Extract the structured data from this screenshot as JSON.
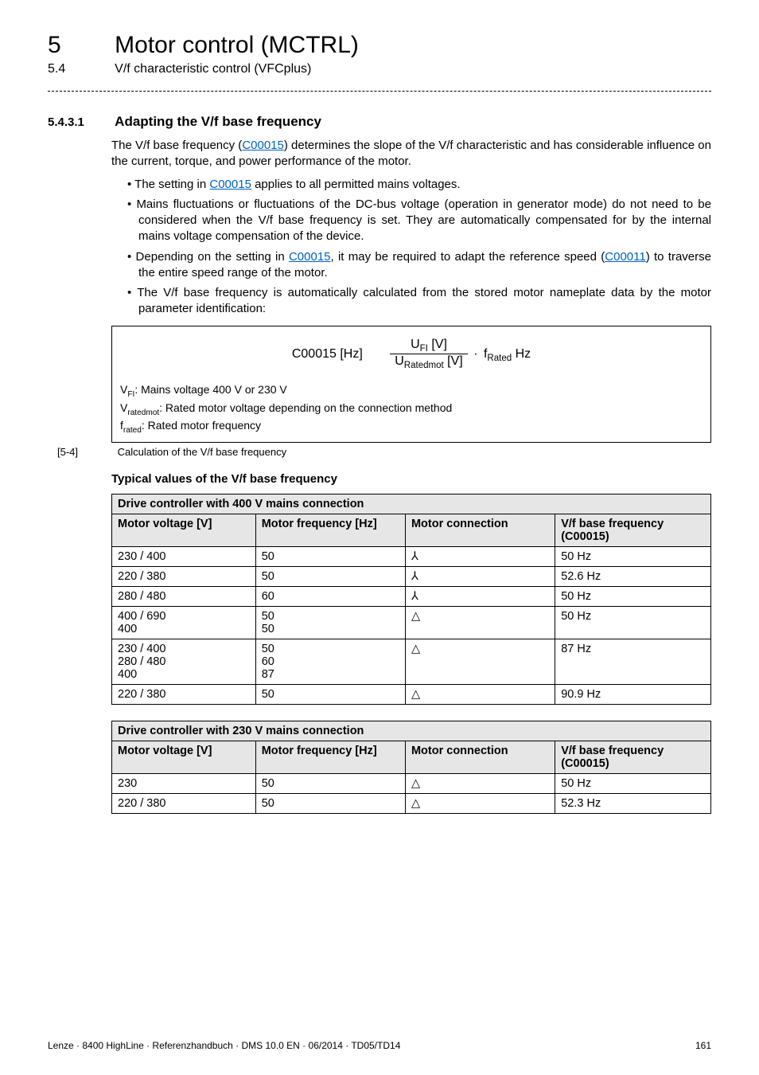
{
  "chapter": {
    "num": "5",
    "title": "Motor control (MCTRL)"
  },
  "subhead": {
    "num": "5.4",
    "title": "V/f characteristic control (VFCplus)"
  },
  "section": {
    "num": "5.4.3.1",
    "title": "Adapting the V/f base frequency"
  },
  "para1_parts": {
    "a": "The V/f base frequency (",
    "link": "C00015",
    "b": ") determines the slope of the V/f characteristic and has considerable influence on the current, torque, and power performance of the motor."
  },
  "bullets": {
    "b1": {
      "a": "The setting in ",
      "link": "C00015",
      "b": " applies to all permitted mains voltages."
    },
    "b2": "Mains fluctuations or fluctuations of the DC-bus voltage (operation in generator mode) do not need to be considered when the V/f base frequency is set. They are automatically compensated for by the internal mains voltage compensation of the device.",
    "b3": {
      "a": "Depending on the setting in ",
      "link1": "C00015",
      "b": ", it may be required to adapt the reference speed (",
      "link2": "C00011",
      "c": ") to traverse the entire speed range of the motor."
    },
    "b4": "The V/f base frequency is automatically calculated from the stored motor nameplate data by the motor parameter identification:"
  },
  "formula": {
    "lhs": "C00015 [Hz]",
    "num": "U<span class=\"sub\">FI</span> [V]",
    "den": "U<span class=\"sub\">Ratedmot</span> [V]",
    "trail": "<span class=\"dot\">·</span> f<span class=\"sub\">Rated</span> Hz",
    "legend": [
      "V<span class=\"sub\">FI</span>: Mains voltage 400 V or 230 V",
      "V<span class=\"sub\">ratedmot</span>: Rated motor voltage depending on the connection method",
      "f<span class=\"sub\">rated</span>: Rated motor frequency"
    ]
  },
  "caption": {
    "lbl": "[5-4]",
    "text": "Calculation of the V/f base frequency"
  },
  "typical_heading": "Typical values of the V/f base frequency",
  "table_header": {
    "c1": "Motor voltage [V]",
    "c2": "Motor frequency [Hz]",
    "c3": "Motor connection",
    "c4_a": "V/f base frequency",
    "c4_b": "(C00015)"
  },
  "table400": {
    "title": "Drive controller with 400 V mains connection",
    "rows": [
      {
        "v": "230 / 400",
        "f": "50",
        "conn": "⅄",
        "base": "50 Hz"
      },
      {
        "v": "220 / 380",
        "f": "50",
        "conn": "⅄",
        "base": "52.6 Hz"
      },
      {
        "v": "280 / 480",
        "f": "60",
        "conn": "⅄",
        "base": "50 Hz"
      },
      {
        "v": "400 / 690<br>400",
        "f": "50<br>50",
        "conn": "△",
        "base": "50 Hz"
      },
      {
        "v": "230 / 400<br>280 / 480<br>400",
        "f": "50<br>60<br>87",
        "conn": "△",
        "base": "87 Hz"
      },
      {
        "v": "220 / 380",
        "f": "50",
        "conn": "△",
        "base": "90.9 Hz"
      }
    ]
  },
  "table230": {
    "title": "Drive controller with 230 V mains connection",
    "rows": [
      {
        "v": "230",
        "f": "50",
        "conn": "△",
        "base": "50 Hz"
      },
      {
        "v": "220 / 380",
        "f": "50",
        "conn": "△",
        "base": "52.3 Hz"
      }
    ]
  },
  "footer": {
    "left": "Lenze · 8400 HighLine · Referenzhandbuch · DMS 10.0 EN · 06/2014 · TD05/TD14",
    "right": "161"
  }
}
